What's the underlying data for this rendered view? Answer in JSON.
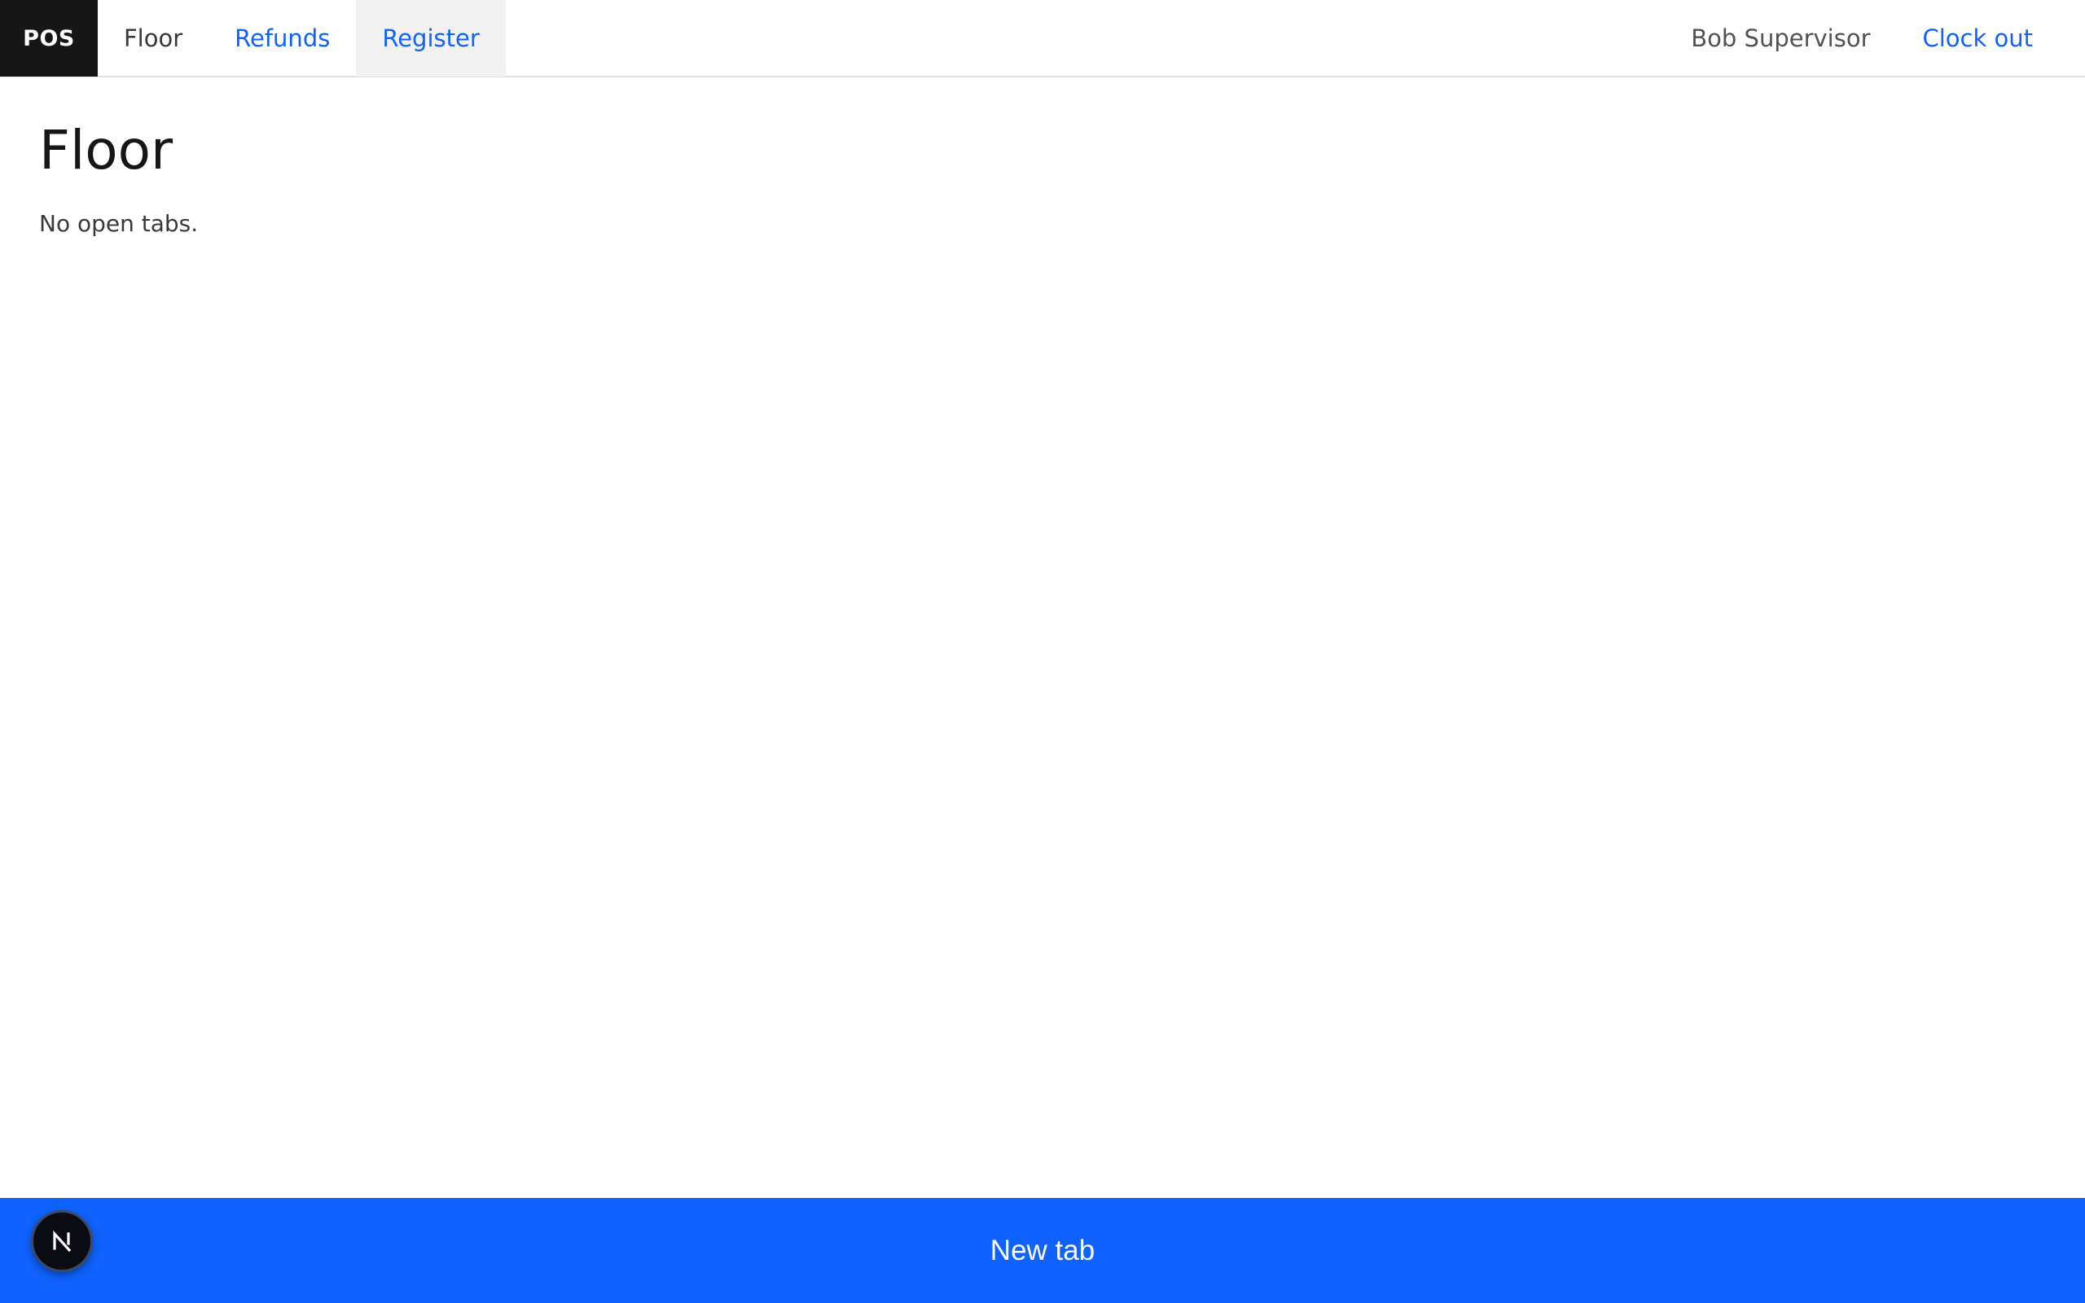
{
  "header": {
    "brand": "POS",
    "nav": [
      {
        "label": "Floor"
      },
      {
        "label": "Refunds"
      },
      {
        "label": "Register"
      }
    ],
    "user_name": "Bob Supervisor",
    "clock_out_label": "Clock out"
  },
  "main": {
    "title": "Floor",
    "empty_message": "No open tabs."
  },
  "footer": {
    "new_tab_label": "New tab"
  },
  "colors": {
    "accent": "#0f62fe",
    "brand_bg": "#161616",
    "hover_bg": "#f2f2f2"
  },
  "icons": {
    "devtools": "next-logo-icon"
  }
}
